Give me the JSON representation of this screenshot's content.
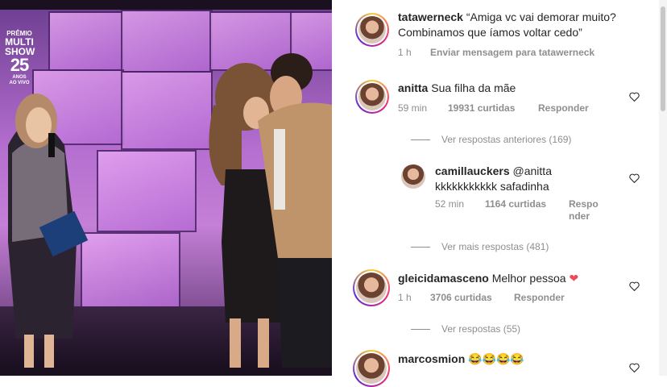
{
  "logo": {
    "line1": "PRÊMIO",
    "line2": "MULTI",
    "line3": "SHOW",
    "years": "25",
    "anos": "ANOS",
    "live": "AO VIVO"
  },
  "caption": {
    "username": "tatawerneck",
    "text_line1": "“Amiga vc vai demorar muito?",
    "text_line2": "Combinamos que íamos voltar cedo”",
    "time": "1 h",
    "action": "Enviar mensagem para tatawerneck"
  },
  "comments": [
    {
      "username": "anitta",
      "text": "Sua filha da mãe",
      "time": "59 min",
      "likes": "19931 curtidas",
      "reply": "Responder",
      "view_replies": "Ver respostas anteriores (169)"
    },
    {
      "username": "camillauckers",
      "mention": "@anitta",
      "text": "kkkkkkkkkkk safadinha",
      "time": "52 min",
      "likes": "1164 curtidas",
      "reply_line1": "Respo",
      "reply_line2": "nder",
      "view_replies": "Ver mais respostas (481)"
    },
    {
      "username": "gleicidamasceno",
      "text": "Melhor pessoa",
      "emoji": "❤",
      "time": "1 h",
      "likes": "3706 curtidas",
      "reply": "Responder",
      "view_replies": "Ver respostas (55)"
    },
    {
      "username": "marcosmion",
      "text": "😂😂😂😂"
    }
  ],
  "icons": {
    "heart": "heart-outline-icon"
  },
  "colors": {
    "text": "#262626",
    "meta": "#8e8e8e",
    "heart_red": "#ed4956"
  }
}
